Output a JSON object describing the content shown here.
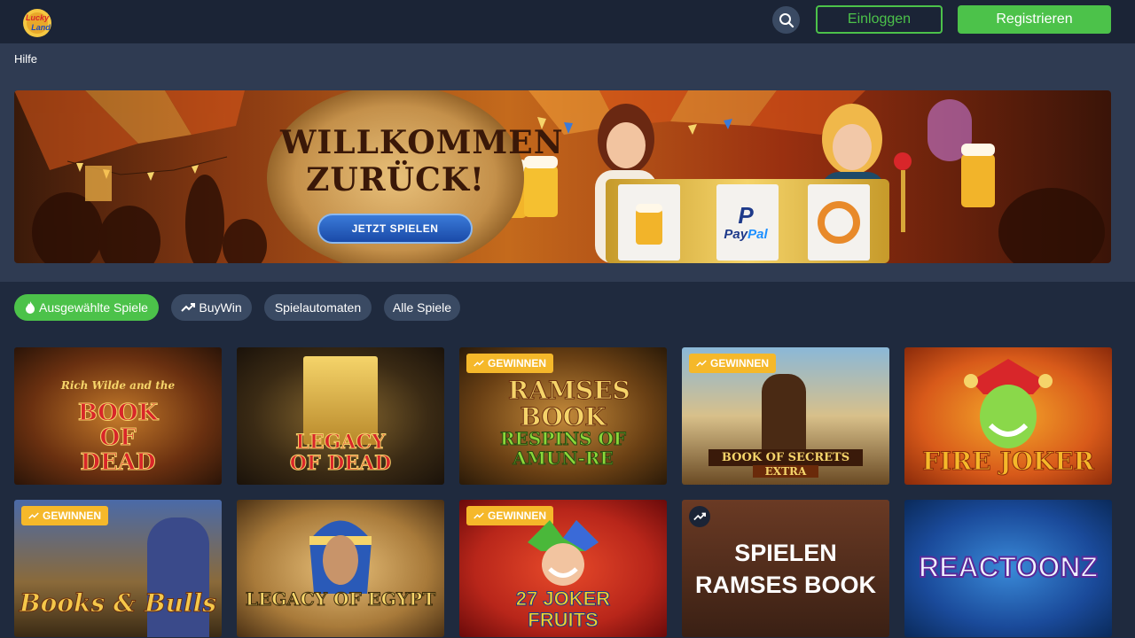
{
  "header": {
    "logo_text": "Lucky Land",
    "login_label": "Einloggen",
    "register_label": "Registrieren",
    "search_icon": "search-icon"
  },
  "help": {
    "label": "Hilfe"
  },
  "banner": {
    "title_line1": "WILLKOMMEN",
    "title_line2": "ZURÜCK!",
    "play_label": "JETZT SPIELEN",
    "paypal_pay": "Pay",
    "paypal_pal": "Pal"
  },
  "filters": [
    {
      "label": "Ausgewählte Spiele",
      "icon": "fire-icon",
      "active": true
    },
    {
      "label": "BuyWin",
      "icon": "trend-up-icon",
      "active": false
    },
    {
      "label": "Spielautomaten",
      "icon": "",
      "active": false
    },
    {
      "label": "Alle Spiele",
      "icon": "",
      "active": false
    }
  ],
  "games": {
    "row1": [
      {
        "title": "BOOK OF DEAD",
        "subtitle": "Rich Wilde and the",
        "badge": ""
      },
      {
        "title": "LEGACY OF DEAD",
        "badge": ""
      },
      {
        "title": "RAMSES BOOK",
        "subtitle": "RESPINS OF AMUN-RE",
        "badge": "GEWINNEN"
      },
      {
        "title": "BOOK OF SECRETS",
        "subtitle": "EXTRA",
        "badge": "GEWINNEN"
      },
      {
        "title": "FIRE JOKER",
        "badge": ""
      }
    ],
    "row2": [
      {
        "title": "Books & Bulls",
        "badge": "GEWINNEN"
      },
      {
        "title": "LEGACY OF EGYPT",
        "badge": ""
      },
      {
        "title": "27 JOKER FRUITS",
        "badge": "GEWINNEN"
      },
      {
        "title": "SPIELEN RAMSES BOOK",
        "badge": ""
      },
      {
        "title": "REACTOONZ",
        "badge": ""
      }
    ]
  },
  "colors": {
    "accent_green": "#4cc24a",
    "badge_yellow": "#f5b82a",
    "background": "#1f2a3e",
    "header": "#1b2436"
  }
}
